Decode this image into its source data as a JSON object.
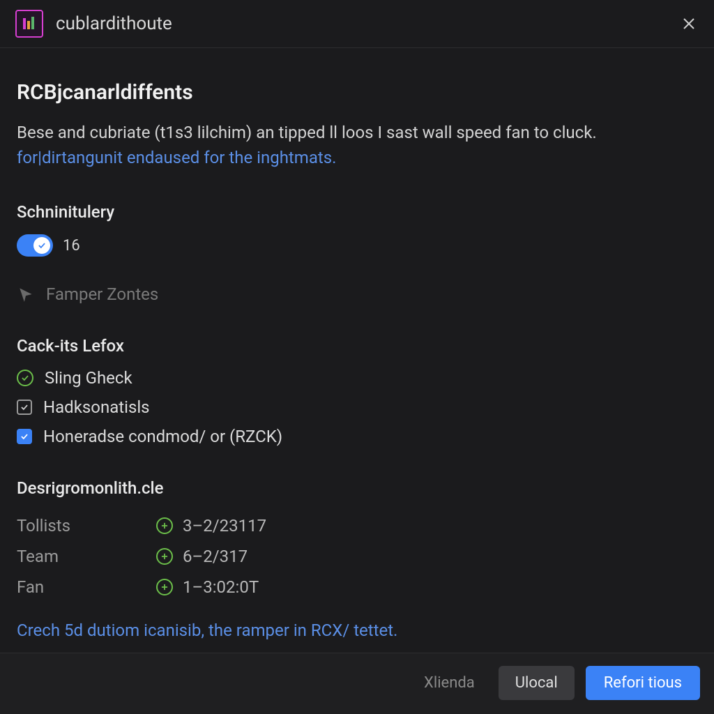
{
  "titlebar": {
    "app_name": "cublardithoute"
  },
  "main": {
    "heading": "RCBjcanarldiffents",
    "desc_plain": "Bese and cubriate (t1s3 lilchim) an tipped ll loos I sast wall speed fan to cluck. ",
    "desc_link": "for|dirtangunit endaused for the inghtmats."
  },
  "toggle_section": {
    "title": "Schninitulery",
    "value": "16"
  },
  "muted_item": "Famper Zontes",
  "checks_section": {
    "title": "Cack-its Lefox",
    "items": [
      {
        "label": "Sling Gheck"
      },
      {
        "label": "Hadksonatisls"
      },
      {
        "label": "Honeradse condmod/ or (RZCK)"
      }
    ]
  },
  "detail_section": {
    "title": "Desrigromonlith.cle",
    "rows": [
      {
        "key": "Tollists",
        "value": "3–2/23117"
      },
      {
        "key": "Team",
        "value": "6–2/317"
      },
      {
        "key": "Fan",
        "value": "1–3:02:0T"
      }
    ],
    "bottom_link": "Crech 5d dutiom icanisib, the ramper in RCX/ tettet."
  },
  "footer": {
    "ghost": "Xlienda",
    "secondary": "Ulocal",
    "primary": "Refori tious"
  }
}
